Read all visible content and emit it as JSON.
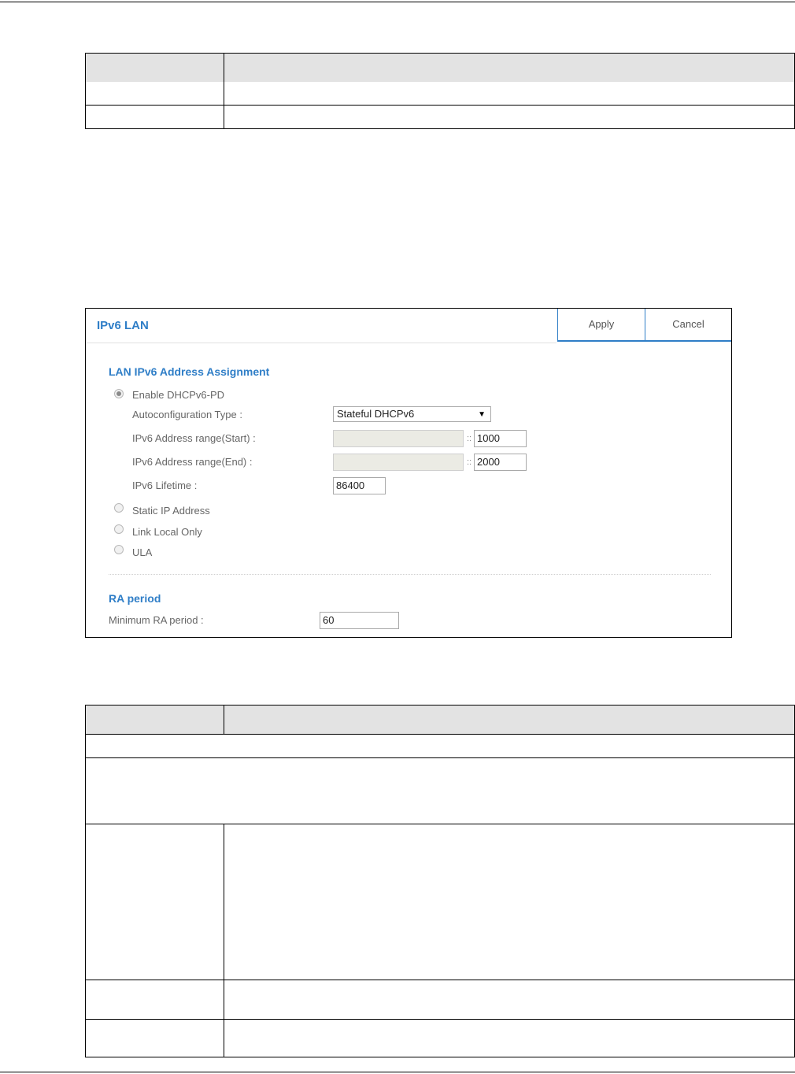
{
  "panel": {
    "title": "IPv6 LAN",
    "apply_label": "Apply",
    "cancel_label": "Cancel",
    "assignment": {
      "section_title": "LAN IPv6 Address Assignment",
      "options": [
        {
          "label": "Enable DHCPv6-PD",
          "selected": true
        },
        {
          "label": "Static IP Address",
          "selected": false
        },
        {
          "label": "Link Local Only",
          "selected": false
        },
        {
          "label": "ULA",
          "selected": false
        }
      ],
      "autoconfig_label": "Autoconfiguration Type :",
      "autoconfig_value": "Stateful DHCPv6",
      "range_start_label": "IPv6 Address range(Start) :",
      "range_start_suffix": "1000",
      "range_end_label": "IPv6 Address range(End) :",
      "range_end_suffix": "2000",
      "separator": "::",
      "lifetime_label": "IPv6 Lifetime :",
      "lifetime_value": "86400"
    },
    "ra": {
      "section_title": "RA period",
      "min_label": "Minimum RA period :",
      "min_value": "60"
    }
  }
}
